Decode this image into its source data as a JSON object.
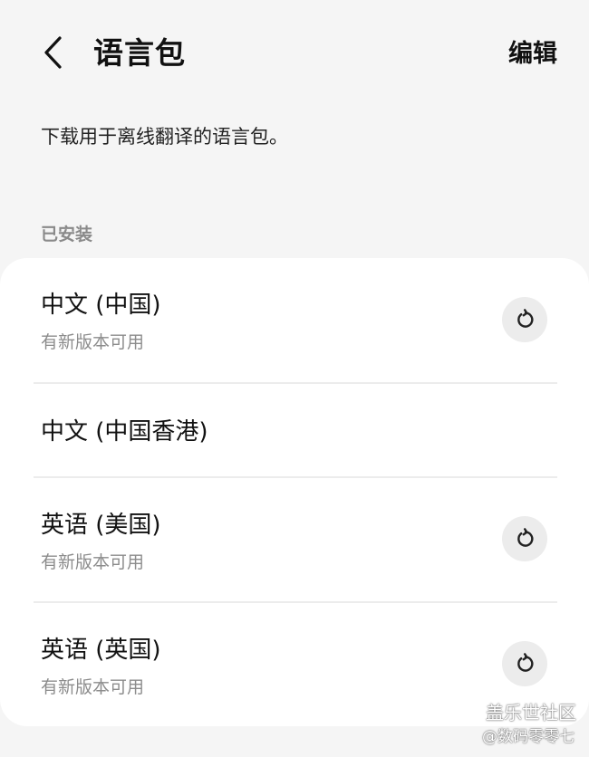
{
  "header": {
    "title": "语言包",
    "edit_label": "编辑"
  },
  "description": "下载用于离线翻译的语言包。",
  "installed": {
    "section_label": "已安装",
    "items": [
      {
        "name": "中文 (中国)",
        "status": "有新版本可用"
      },
      {
        "name": "中文 (中国香港)",
        "status": ""
      },
      {
        "name": "英语 (美国)",
        "status": "有新版本可用"
      },
      {
        "name": "英语 (英国)",
        "status": "有新版本可用"
      }
    ]
  },
  "watermark": {
    "line1": "盖乐世社区",
    "line2": "@数码零零七"
  },
  "icons": {
    "back": "chevron-left-icon",
    "update": "refresh-icon"
  }
}
